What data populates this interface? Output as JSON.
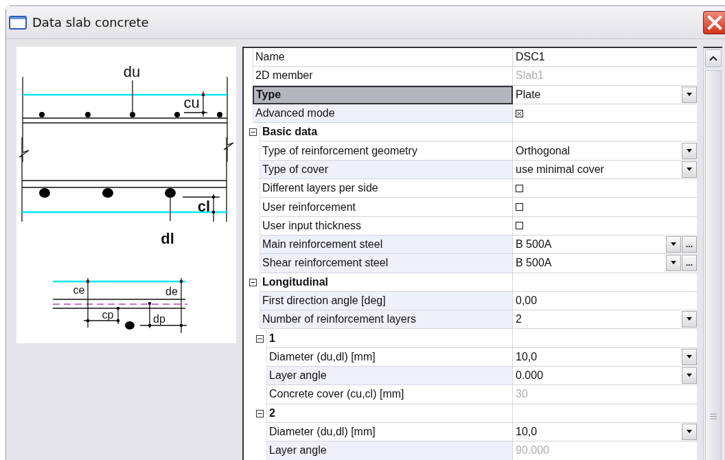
{
  "window": {
    "title": "Data slab concrete"
  },
  "diagram": {
    "labels": [
      "du",
      "cu",
      "cl",
      "dl",
      "ce",
      "de",
      "cp",
      "dp"
    ]
  },
  "properties": [
    {
      "label": "Name",
      "value": "DSC1",
      "kind": "text",
      "selected": false,
      "shaded": false
    },
    {
      "label": "2D member",
      "value": "Slab1",
      "kind": "text",
      "disabled": true,
      "selected": false,
      "shaded": false
    },
    {
      "label": "Type",
      "value": "Plate",
      "kind": "dropdown",
      "selected": true,
      "shaded": false
    },
    {
      "label": "Advanced mode",
      "kind": "checkbox",
      "checked": true,
      "selected": false,
      "shaded": true
    },
    {
      "label": "Basic data",
      "kind": "group",
      "expanded": true,
      "selected": false,
      "shaded": false,
      "children": [
        {
          "label": "Type of reinforcement geometry",
          "value": "Orthogonal",
          "kind": "dropdown",
          "selected": false,
          "shaded": false
        },
        {
          "label": "Type of cover",
          "value": "use minimal cover",
          "kind": "dropdown",
          "selected": false,
          "shaded": true
        },
        {
          "label": "Different layers per side",
          "kind": "checkbox",
          "checked": false,
          "selected": false,
          "shaded": false
        },
        {
          "label": "User reinforcement",
          "kind": "checkbox",
          "checked": false,
          "selected": false,
          "shaded": false
        },
        {
          "label": "User input thickness",
          "kind": "checkbox",
          "checked": false,
          "selected": false,
          "shaded": false
        },
        {
          "label": "Main reinforcement steel",
          "value": "B 500A",
          "kind": "dropdown_more",
          "button": "...",
          "selected": false,
          "shaded": true
        },
        {
          "label": "Shear reinforcement steel",
          "value": "B 500A",
          "kind": "dropdown_more",
          "button": "...",
          "selected": false,
          "shaded": true
        }
      ]
    },
    {
      "label": "Longitudinal",
      "kind": "group",
      "expanded": true,
      "selected": false,
      "shaded": false,
      "children": [
        {
          "label": "First direction angle [deg]",
          "value": "0,00",
          "kind": "text",
          "selected": false,
          "shaded": true
        },
        {
          "label": "Number of reinforcement layers",
          "value": "2",
          "kind": "dropdown",
          "selected": false,
          "shaded": true
        },
        {
          "label": "1",
          "kind": "group",
          "expanded": true,
          "selected": false,
          "shaded": false,
          "children": [
            {
              "label": "Diameter (du,dl) [mm]",
              "value": "10,0",
              "kind": "dropdown",
              "selected": false,
              "shaded": false
            },
            {
              "label": "Layer angle",
              "value": "0.000",
              "kind": "dropdown",
              "selected": false,
              "shaded": true
            },
            {
              "label": "Concrete cover (cu,cl) [mm]",
              "value": "30",
              "kind": "text",
              "disabled": true,
              "selected": false,
              "shaded": false
            }
          ]
        },
        {
          "label": "2",
          "kind": "group",
          "expanded": true,
          "selected": false,
          "shaded": false,
          "children": [
            {
              "label": "Diameter (du,dl) [mm]",
              "value": "10,0",
              "kind": "dropdown",
              "selected": false,
              "shaded": false
            },
            {
              "label": "Layer angle",
              "value": "90.000",
              "kind": "text",
              "disabled": true,
              "selected": false,
              "shaded": true
            }
          ]
        }
      ]
    }
  ]
}
